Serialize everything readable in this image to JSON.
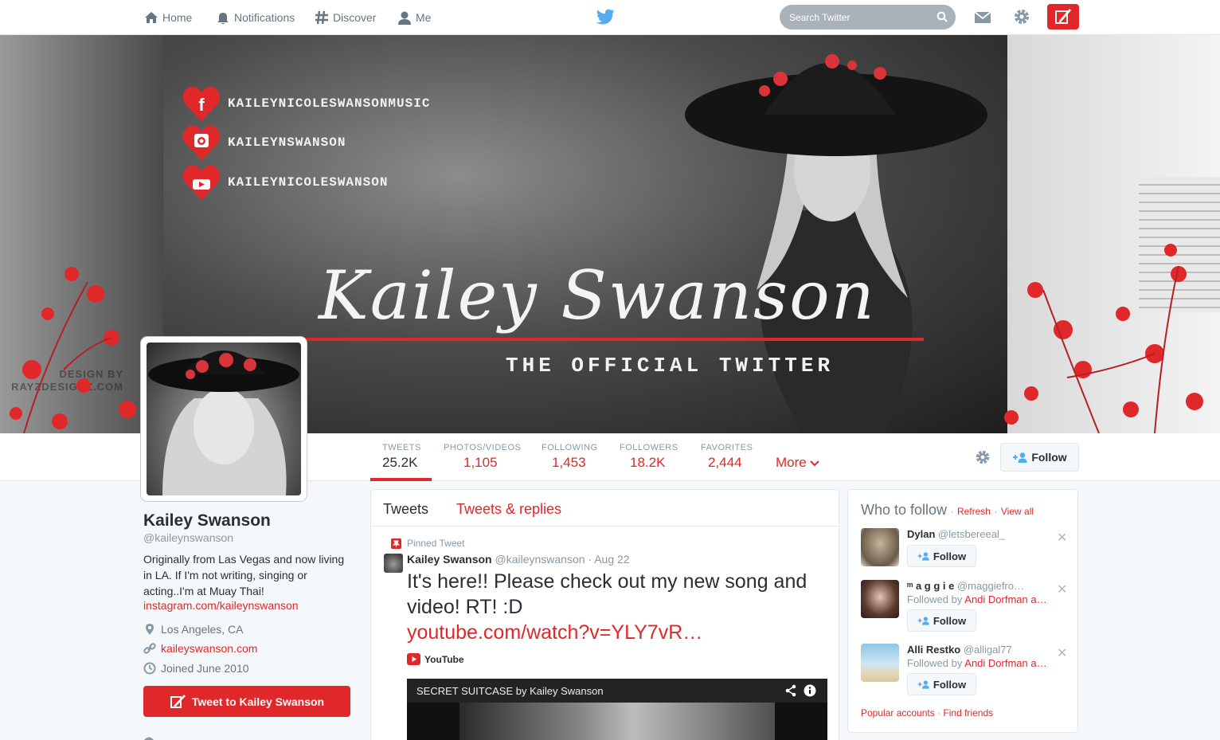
{
  "nav": {
    "home": "Home",
    "notifications": "Notifications",
    "discover": "Discover",
    "me": "Me",
    "search_placeholder": "Search Twitter"
  },
  "banner": {
    "social": [
      {
        "icon": "facebook-icon",
        "text": "KAILEYNICOLESWANSONMUSIC"
      },
      {
        "icon": "instagram-icon",
        "text": "KAILEYNSWANSON"
      },
      {
        "icon": "youtube-icon",
        "text": "KAILEYNICOLESWANSON"
      }
    ],
    "name": "Kailey Swanson",
    "subtitle": "THE OFFICIAL TWITTER",
    "credit_line1": "DESIGN BY",
    "credit_line2": "RAYZDESIGNZ.COM"
  },
  "stats": [
    {
      "label": "TWEETS",
      "value": "25.2K"
    },
    {
      "label": "PHOTOS/VIDEOS",
      "value": "1,105"
    },
    {
      "label": "FOLLOWING",
      "value": "1,453"
    },
    {
      "label": "FOLLOWERS",
      "value": "18.2K"
    },
    {
      "label": "FAVORITES",
      "value": "2,444"
    }
  ],
  "more_label": "More",
  "follow_label": "Follow",
  "profile": {
    "name": "Kailey Swanson",
    "handle": "@kaileynswanson",
    "bio": "Originally from Las Vegas and now living in LA. If I'm not writing, singing or acting..I'm at Muay Thai!",
    "bio_link": "instagram.com/kaileynswanson",
    "location": "Los Angeles, CA",
    "website": "kaileyswanson.com",
    "joined": "Joined June 2010",
    "tweet_to": "Tweet to Kailey Swanson"
  },
  "timeline": {
    "tabs": [
      "Tweets",
      "Tweets & replies"
    ],
    "pinned_label": "Pinned Tweet",
    "tweet": {
      "author": "Kailey Swanson",
      "handle": "@kaileynswanson",
      "sep": "·",
      "date": "Aug 22",
      "text": "It's here!! Please check out my new song and video! RT! :D",
      "url": "youtube.com/watch?v=YLY7vR…",
      "source": "YouTube",
      "video_title": "SECRET SUITCASE by Kailey Swanson"
    }
  },
  "who_to_follow": {
    "title": "Who to follow",
    "dot": "·",
    "refresh": "Refresh",
    "view_all": "View all",
    "suggestions": [
      {
        "name": "Dylan",
        "handle": "@letsbereeal_",
        "followed_by": "",
        "followed_by_name": "",
        "button": "Follow"
      },
      {
        "name": "ᵐ a g g i e",
        "handle": "@maggiefro…",
        "followed_by": "Followed by",
        "followed_by_name": "Andi Dorfman a…",
        "button": "Follow"
      },
      {
        "name": "Alli Restko",
        "handle": "@alligal77",
        "followed_by": "Followed by",
        "followed_by_name": "Andi Dorfman a…",
        "button": "Follow"
      }
    ],
    "popular": "Popular accounts",
    "find_friends": "Find friends"
  },
  "colors": {
    "accent": "#e0282a",
    "text": "#292f33",
    "muted": "#8899a6"
  }
}
